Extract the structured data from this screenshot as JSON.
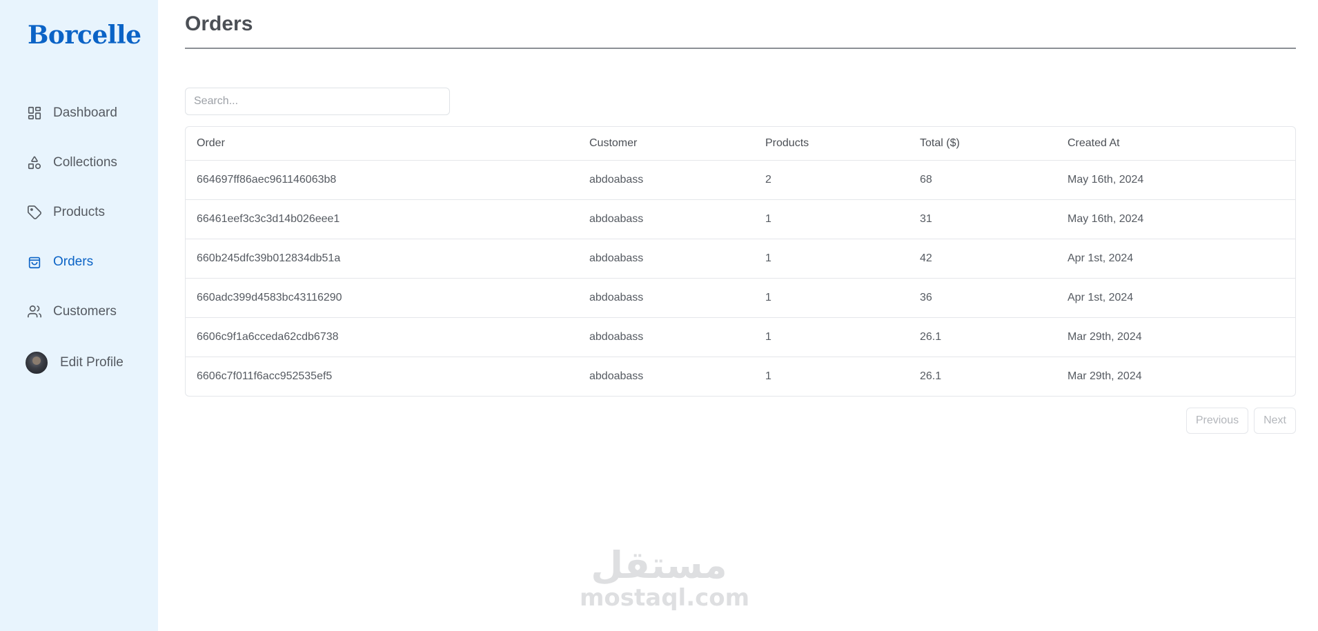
{
  "sidebar": {
    "logo": "Borcelle",
    "items": [
      {
        "label": "Dashboard",
        "icon": "dashboard-icon"
      },
      {
        "label": "Collections",
        "icon": "shapes-icon"
      },
      {
        "label": "Products",
        "icon": "tag-icon"
      },
      {
        "label": "Orders",
        "icon": "shopping-bag-icon",
        "active": true
      },
      {
        "label": "Customers",
        "icon": "users-icon"
      }
    ],
    "profile": {
      "label": "Edit Profile",
      "icon": "avatar"
    }
  },
  "main": {
    "title": "Orders",
    "search": {
      "placeholder": "Search...",
      "value": ""
    },
    "table": {
      "columns": [
        "Order",
        "Customer",
        "Products",
        "Total ($)",
        "Created At"
      ],
      "rows": [
        [
          "664697ff86aec961146063b8",
          "abdoabass",
          "2",
          "68",
          "May 16th, 2024"
        ],
        [
          "66461eef3c3c3d14b026eee1",
          "abdoabass",
          "1",
          "31",
          "May 16th, 2024"
        ],
        [
          "660b245dfc39b012834db51a",
          "abdoabass",
          "1",
          "42",
          "Apr 1st, 2024"
        ],
        [
          "660adc399d4583bc43116290",
          "abdoabass",
          "1",
          "36",
          "Apr 1st, 2024"
        ],
        [
          "6606c9f1a6cceda62cdb6738",
          "abdoabass",
          "1",
          "26.1",
          "Mar 29th, 2024"
        ],
        [
          "6606c7f011f6acc952535ef5",
          "abdoabass",
          "1",
          "26.1",
          "Mar 29th, 2024"
        ]
      ]
    },
    "pagination": {
      "previous": "Previous",
      "next": "Next"
    }
  },
  "watermark": {
    "arabic": "مستقل",
    "latin": "mostaql.com"
  },
  "colors": {
    "accent": "#0b63c6",
    "sidebar_bg": "#e8f4fd"
  }
}
